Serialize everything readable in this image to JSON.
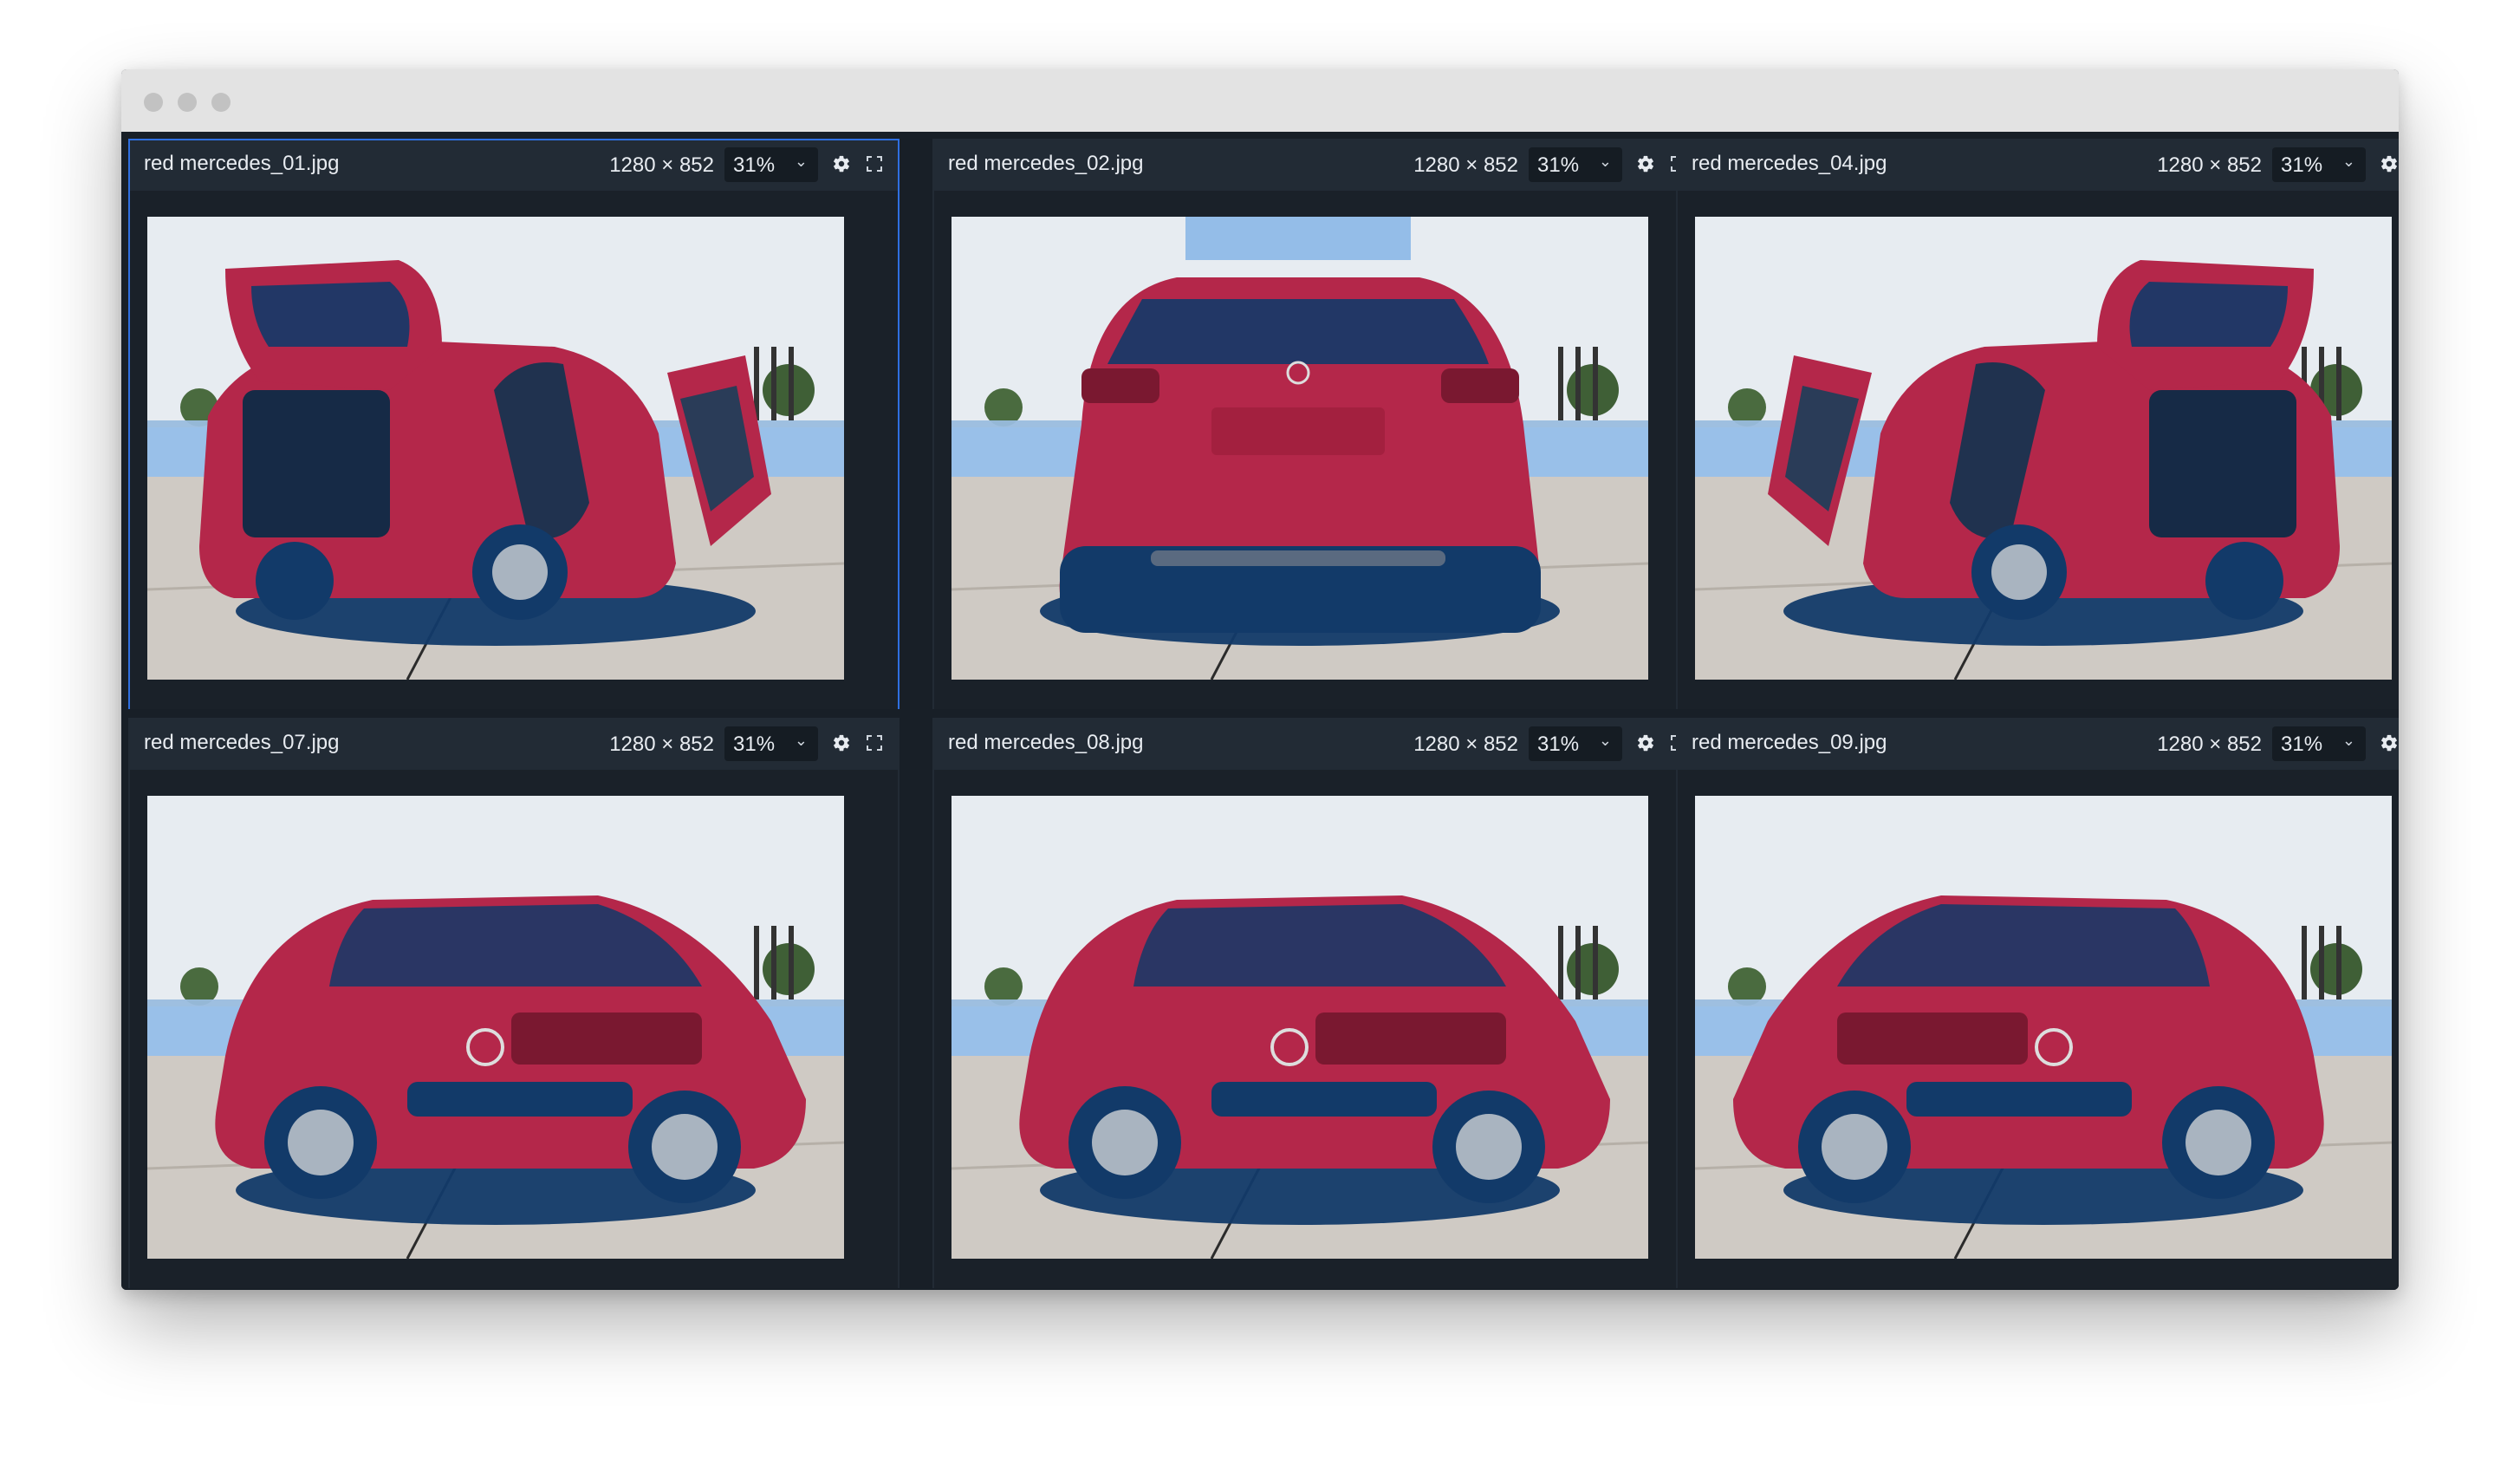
{
  "window": {
    "controls": [
      "close",
      "minimize",
      "zoom"
    ]
  },
  "panels": [
    {
      "file": "red mercedes_01.jpg",
      "dims": "1280 × 852",
      "zoom": "31%",
      "selected": true,
      "view": "rear-open"
    },
    {
      "file": "red mercedes_02.jpg",
      "dims": "1280 × 852",
      "zoom": "31%",
      "selected": false,
      "view": "rear"
    },
    {
      "file": "red mercedes_04.jpg",
      "dims": "1280 × 852",
      "zoom": "31%",
      "selected": false,
      "view": "rear-open-mirror"
    },
    {
      "file": "red mercedes_07.jpg",
      "dims": "1280 × 852",
      "zoom": "31%",
      "selected": false,
      "view": "front-three-quarter"
    },
    {
      "file": "red mercedes_08.jpg",
      "dims": "1280 × 852",
      "zoom": "31%",
      "selected": false,
      "view": "rear-three-quarter"
    },
    {
      "file": "red mercedes_09.jpg",
      "dims": "1280 × 852",
      "zoom": "31%",
      "selected": false,
      "view": "rear-three-quarter-mirror"
    }
  ],
  "icons": {
    "zoom_dropdown": "chevron-down-icon",
    "settings": "gear-icon",
    "fullscreen": "expand-icon"
  },
  "colors": {
    "panel_bg": "#222b35",
    "selection": "#2f6fe0",
    "car_red": "#b4274a",
    "mask_blue": "#123a69",
    "mask_overlay": "#7fb2e6"
  }
}
